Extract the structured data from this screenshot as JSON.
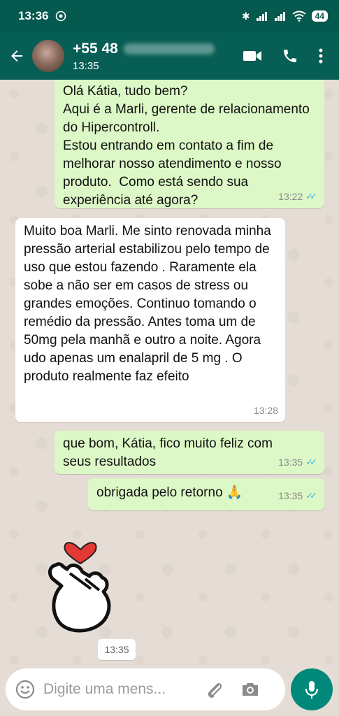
{
  "status_bar": {
    "time": "13:36",
    "battery": "44"
  },
  "header": {
    "contact_name": "+55 48",
    "last_seen": "13:35"
  },
  "messages": [
    {
      "direction": "out",
      "text": "Olá Kátia, tudo bem?\nAqui é a Marli, gerente de relacionamento do Hipercontroll.\nEstou entrando em contato a fim de melhorar nosso atendimento e nosso produto.  Como está sendo sua experiência até agora?",
      "time": "13:22"
    },
    {
      "direction": "in",
      "text": "Muito boa Marli. Me sinto renovada minha pressão arterial estabilizou pelo tempo de uso que estou fazendo . Raramente ela sobe a não ser em casos de stress ou grandes emoções. Continuo tomando o remédio da pressão. Antes toma um de 50mg pela manhã e outro a noite. Agora udo apenas um enalapril de 5 mg . O produto realmente faz efeito",
      "time": "13:28"
    },
    {
      "direction": "out",
      "text": "que bom, Kátia, fico muito feliz com seus resultados",
      "time": "13:35"
    },
    {
      "direction": "out",
      "text": "obrigada pelo retorno 🙏",
      "time": "13:35"
    }
  ],
  "sticker": {
    "time": "13:35",
    "icon": "heart-hand-sticker"
  },
  "composer": {
    "placeholder": "Digite uma mens..."
  },
  "colors": {
    "header": "#075e54",
    "outgoing_bubble": "#dcf8c6",
    "incoming_bubble": "#ffffff",
    "read_ticks": "#34b7f1",
    "mic_button": "#00897b"
  }
}
